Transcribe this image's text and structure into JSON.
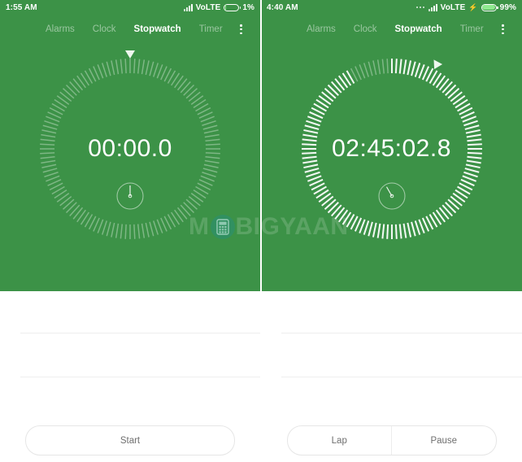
{
  "app": {
    "name": "Stopwatch",
    "accent_green": "#3c9247",
    "surface_white": "#ffffff",
    "divider_color": "#eeeeee",
    "button_text_color": "#6f6f6f"
  },
  "watermark": {
    "text_before": "M",
    "text_after": "BIGYAAN",
    "full_text": "MOBIGYAAN",
    "phone_icon": "mobile-phone-icon"
  },
  "panels": [
    {
      "id": "left",
      "status_bar": {
        "time": "1:55 AM",
        "has_notification_dots": false,
        "signal_icon": "signal-bars-icon",
        "network": "VoLTE",
        "charging": false,
        "battery_icon": "battery-icon",
        "battery_percent": "1%",
        "battery_fill_ratio": 0.02
      },
      "tabs": [
        {
          "label": "Alarms",
          "active": false
        },
        {
          "label": "Clock",
          "active": false
        },
        {
          "label": "Stopwatch",
          "active": true
        },
        {
          "label": "Timer",
          "active": false
        }
      ],
      "overflow_icon": "overflow-menu-icon",
      "dial": {
        "time_display": "00:00.0",
        "marker_icon": "progress-marker-triangle-icon",
        "marker_angle_deg": 0,
        "progress_angle_deg": 0,
        "tick_count": 120,
        "lap_dial_icon": "lap-clock-icon",
        "lap_hand_angle_deg": 0
      },
      "laps": [],
      "buttons": [
        {
          "label": "Start",
          "name": "start-button"
        }
      ]
    },
    {
      "id": "right",
      "status_bar": {
        "time": "4:40 AM",
        "has_notification_dots": true,
        "notification_icon": "notification-dots-icon",
        "signal_icon": "signal-bars-icon",
        "network": "VoLTE",
        "charging": true,
        "charging_icon": "charging-bolt-icon",
        "battery_icon": "battery-icon",
        "battery_percent": "99%",
        "battery_fill_ratio": 0.99
      },
      "tabs": [
        {
          "label": "Alarms",
          "active": false
        },
        {
          "label": "Clock",
          "active": false
        },
        {
          "label": "Stopwatch",
          "active": true
        },
        {
          "label": "Timer",
          "active": false
        }
      ],
      "overflow_icon": "overflow-menu-icon",
      "dial": {
        "time_display": "02:45:02.8",
        "marker_icon": "progress-marker-triangle-icon",
        "marker_angle_deg": 28,
        "progress_angle_deg": 332,
        "tick_count": 120,
        "lap_dial_icon": "lap-clock-icon",
        "lap_hand_angle_deg": 330
      },
      "laps": [],
      "buttons": [
        {
          "label": "Lap",
          "name": "lap-button"
        },
        {
          "label": "Pause",
          "name": "pause-button"
        }
      ]
    }
  ]
}
